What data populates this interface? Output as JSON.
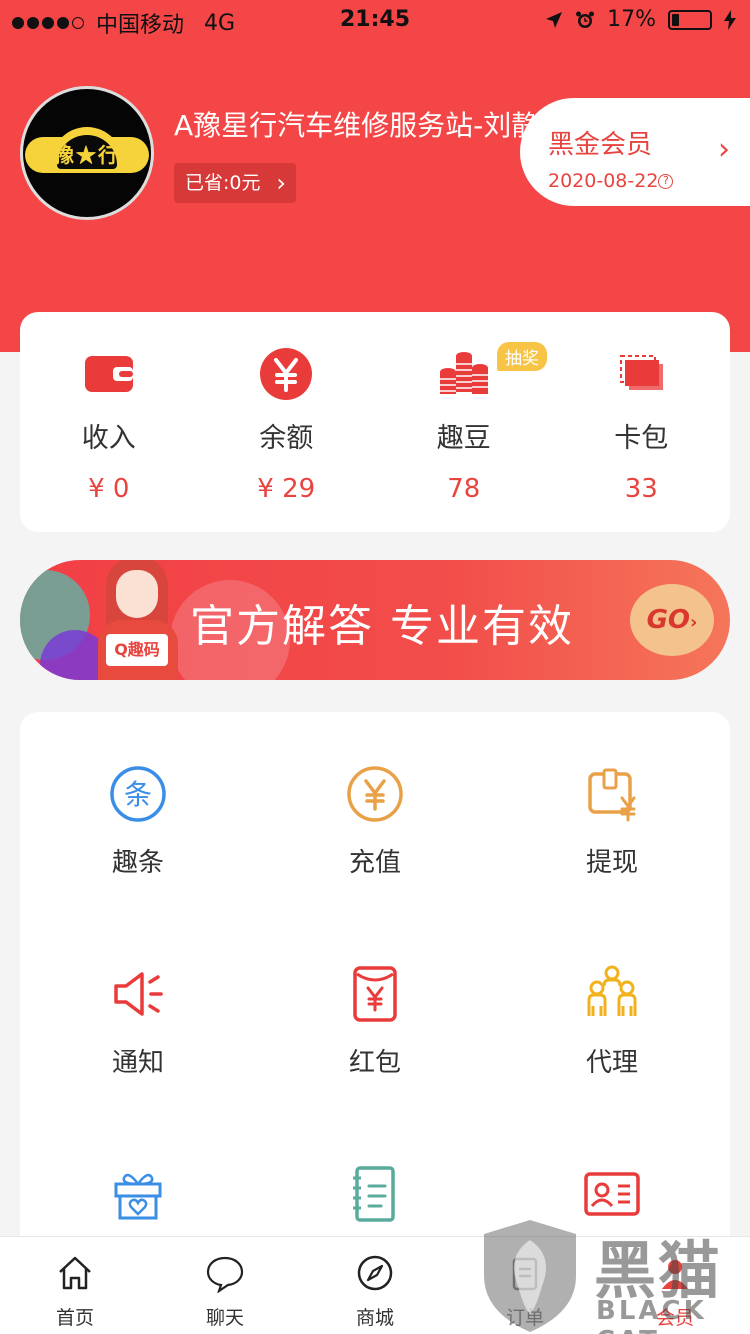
{
  "status_bar": {
    "carrier": "中国移动",
    "network": "4G",
    "time": "21:45",
    "battery": "17%"
  },
  "profile": {
    "shop_name": "A豫星行汽车维修服务站-刘静",
    "avatar_text": "豫★行",
    "saved_label": "已省:0元"
  },
  "vip": {
    "title": "黑金会员",
    "date": "2020-08-22"
  },
  "stats": [
    {
      "label": "收入",
      "value": "¥ 0",
      "icon": "wallet-icon"
    },
    {
      "label": "余额",
      "value": "¥ 29",
      "icon": "yuan-coin-icon"
    },
    {
      "label": "趣豆",
      "value": "78",
      "icon": "coin-stack-icon",
      "badge": "抽奖"
    },
    {
      "label": "卡包",
      "value": "33",
      "icon": "cards-icon"
    }
  ],
  "banner": {
    "text": "官方解答 专业有效",
    "agent_tag": "Q趣码",
    "go_label": "GO"
  },
  "grid": [
    {
      "label": "趣条",
      "icon": "qutiao-icon"
    },
    {
      "label": "充值",
      "icon": "recharge-icon"
    },
    {
      "label": "提现",
      "icon": "withdraw-icon"
    },
    {
      "label": "通知",
      "icon": "notice-icon"
    },
    {
      "label": "红包",
      "icon": "red-packet-icon"
    },
    {
      "label": "代理",
      "icon": "agent-icon"
    },
    {
      "label": "",
      "icon": "gift-icon"
    },
    {
      "label": "",
      "icon": "notebook-icon"
    },
    {
      "label": "",
      "icon": "id-card-icon"
    }
  ],
  "tabs": [
    {
      "label": "首页",
      "icon": "home-icon"
    },
    {
      "label": "聊天",
      "icon": "chat-icon"
    },
    {
      "label": "商城",
      "icon": "compass-icon"
    },
    {
      "label": "订单",
      "icon": "order-icon"
    },
    {
      "label": "会员",
      "icon": "member-icon"
    }
  ],
  "watermark": {
    "cn": "黑猫",
    "en": "BLACK CAT"
  },
  "colors": {
    "brand_red": "#f44646",
    "accent_red": "#e8443f",
    "orange": "#e9a148",
    "blue": "#3a8ee6",
    "teal": "#5aab9c",
    "yellow": "#f7c446"
  }
}
